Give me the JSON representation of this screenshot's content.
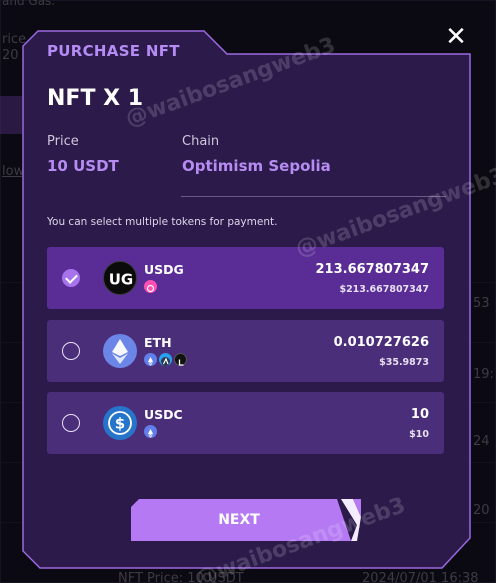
{
  "background": {
    "texts": [
      "and Gas.",
      "rice",
      "20",
      "low",
      "53",
      "19:",
      "24",
      "20",
      "NFT Price: 10 USDT",
      "2024/07/01 16:38"
    ]
  },
  "modal": {
    "header": "PURCHASE NFT",
    "title": "NFT X 1",
    "price_label": "Price",
    "price_value": "10 USDT",
    "chain_label": "Chain",
    "chain_value": "Optimism Sepolia",
    "hint": "You can select multiple tokens for payment.",
    "close_symbol": "✕",
    "next_label": "NEXT"
  },
  "tokens": [
    {
      "name": "USDG",
      "amount": "213.667807347",
      "usd": "$213.667807347",
      "selected": true,
      "logo": "usdg-logo",
      "chains": [
        "optimism-pink-chip"
      ]
    },
    {
      "name": "ETH",
      "amount": "0.010727626",
      "usd": "$35.9873",
      "selected": false,
      "logo": "eth-logo",
      "chains": [
        "eth-chip",
        "arbitrum-chip",
        "linea-chip"
      ]
    },
    {
      "name": "USDC",
      "amount": "10",
      "usd": "$10",
      "selected": false,
      "logo": "usdc-logo",
      "chains": [
        "eth-chip"
      ]
    }
  ],
  "watermark": "@waibosangweb3",
  "colors": {
    "accent": "#a773ec",
    "modal_bg": "#2b1a4a",
    "card": "#4a2e7a",
    "card_selected": "#5a2d96",
    "label_purple": "#b68cf2"
  }
}
